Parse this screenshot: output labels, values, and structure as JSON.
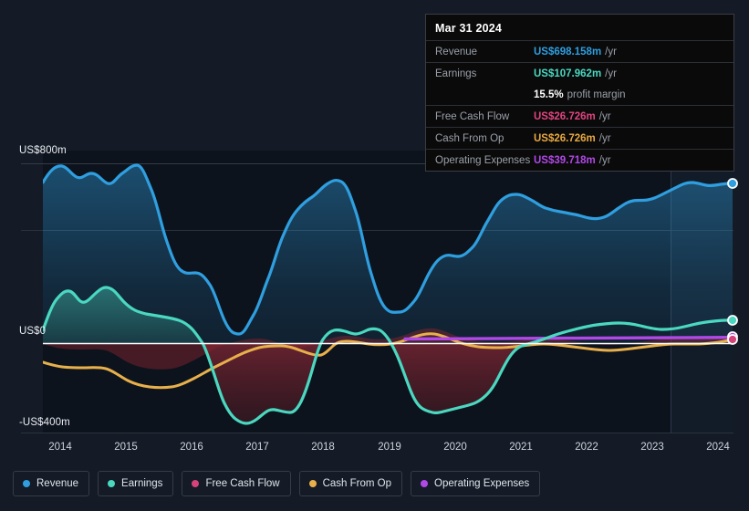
{
  "axes": {
    "y_ticks": [
      "US$800m",
      "US$0",
      "-US$400m"
    ],
    "x_ticks": [
      "2014",
      "2015",
      "2016",
      "2017",
      "2018",
      "2019",
      "2020",
      "2021",
      "2022",
      "2023",
      "2024"
    ]
  },
  "tooltip": {
    "date": "Mar 31 2024",
    "rows": [
      {
        "label": "Revenue",
        "value": "US$698.158m",
        "unit": "/yr",
        "color": "#2f9fe0"
      },
      {
        "label": "Earnings",
        "value": "US$107.962m",
        "unit": "/yr",
        "color": "#4ad8c0"
      },
      {
        "label": "Free Cash Flow",
        "value": "US$26.726m",
        "unit": "/yr",
        "color": "#e0447e"
      },
      {
        "label": "Cash From Op",
        "value": "US$26.726m",
        "unit": "/yr",
        "color": "#e8a93f"
      },
      {
        "label": "Operating Expenses",
        "value": "US$39.718m",
        "unit": "/yr",
        "color": "#b148e8"
      }
    ],
    "profit_margin_pct": "15.5%",
    "profit_margin_label": "profit margin"
  },
  "legend": {
    "items": [
      {
        "label": "Revenue",
        "color": "#2f9fe0"
      },
      {
        "label": "Earnings",
        "color": "#4ad8c0"
      },
      {
        "label": "Free Cash Flow",
        "color": "#d6437a"
      },
      {
        "label": "Cash From Op",
        "color": "#e8b04b"
      },
      {
        "label": "Operating Expenses",
        "color": "#b148e8"
      }
    ]
  },
  "chart_data": {
    "type": "line",
    "title": "",
    "xlabel": "",
    "ylabel": "US$",
    "units": "US$ millions per year",
    "grid": true,
    "legend_position": "bottom",
    "xlim": [
      2013.6,
      2024.45
    ],
    "ylim": [
      -480,
      860
    ],
    "y_gridlines": [
      800,
      400,
      0
    ],
    "zero_line": 0,
    "forecast_divider_x": 2023.0,
    "x": [
      2013.65,
      2013.9,
      2014.15,
      2014.4,
      2014.65,
      2014.9,
      2015.15,
      2015.4,
      2015.65,
      2015.9,
      2016.15,
      2016.4,
      2016.65,
      2016.9,
      2017.15,
      2017.4,
      2017.65,
      2017.9,
      2018.15,
      2018.4,
      2018.65,
      2018.9,
      2019.15,
      2019.4,
      2019.65,
      2019.9,
      2020.15,
      2020.4,
      2020.65,
      2020.9,
      2021.15,
      2021.4,
      2021.65,
      2021.9,
      2022.15,
      2022.4,
      2022.65,
      2022.9,
      2023.15,
      2023.4,
      2023.65,
      2023.9,
      2024.15,
      2024.35
    ],
    "series": [
      {
        "name": "Revenue",
        "color": "#2f9fe0",
        "values": [
          712,
          770,
          786,
          762,
          742,
          778,
          788,
          742,
          648,
          558,
          512,
          492,
          484,
          470,
          498,
          566,
          638,
          700,
          722,
          690,
          604,
          512,
          430,
          390,
          372,
          398,
          436,
          438,
          442,
          520,
          628,
          670,
          646,
          600,
          584,
          596,
          642,
          656,
          662,
          644,
          630,
          616,
          618,
          648,
          698
        ]
      },
      {
        "name": "Earnings",
        "color": "#4ad8c0",
        "values": [
          60,
          176,
          204,
          160,
          186,
          214,
          180,
          156,
          140,
          134,
          132,
          126,
          120,
          104,
          96,
          40,
          -110,
          -230,
          -330,
          -394,
          -360,
          -326,
          -352,
          -372,
          -190,
          10,
          58,
          74,
          50,
          74,
          86,
          60,
          -80,
          -212,
          -270,
          -280,
          -248,
          -206,
          -186,
          -170,
          -120,
          -44,
          36,
          104,
          108
        ]
      },
      {
        "name": "Free Cash Flow",
        "color": "#d6437a",
        "values": [
          null,
          null,
          null,
          null,
          null,
          null,
          null,
          null,
          null,
          null,
          null,
          null,
          null,
          null,
          null,
          null,
          null,
          null,
          null,
          null,
          null,
          null,
          null,
          null,
          null,
          null,
          null,
          null,
          null,
          null,
          null,
          null,
          null,
          null,
          null,
          null,
          null,
          null,
          null,
          null,
          null,
          null,
          null,
          26.7
        ],
        "note": "overlaps Cash From Op; visible only as endpoint marker at right edge"
      },
      {
        "name": "Cash From Op",
        "color": "#e8b04b",
        "values": [
          -86,
          -96,
          -104,
          -104,
          -100,
          -104,
          -142,
          -160,
          -166,
          -168,
          -172,
          -164,
          -140,
          -108,
          -84,
          -60,
          -40,
          -20,
          -14,
          -32,
          -64,
          -70,
          -54,
          -38,
          -26,
          -26,
          -34,
          -40,
          -40,
          -30,
          28,
          38,
          14,
          -12,
          -18,
          -20,
          -22,
          -34,
          -46,
          -44,
          -38,
          -24,
          -14,
          -6,
          26.7
        ]
      },
      {
        "name": "Operating Expenses",
        "color": "#b148e8",
        "starts_at_x": 2021.0,
        "values": [
          null,
          null,
          null,
          null,
          null,
          null,
          null,
          null,
          null,
          null,
          null,
          null,
          null,
          null,
          null,
          null,
          null,
          null,
          null,
          null,
          null,
          null,
          null,
          null,
          null,
          null,
          null,
          null,
          null,
          22,
          24,
          26,
          28,
          30,
          31,
          32,
          33,
          34,
          35,
          36,
          37,
          38,
          39,
          39.7
        ]
      }
    ]
  },
  "colors": {
    "background": "#141b26",
    "plot_background": "#0e141e",
    "forecast_background": "#131d2a",
    "gridline": "#2a323d",
    "zero_line": "#ffffff",
    "negative_fill": "#6d2028"
  }
}
